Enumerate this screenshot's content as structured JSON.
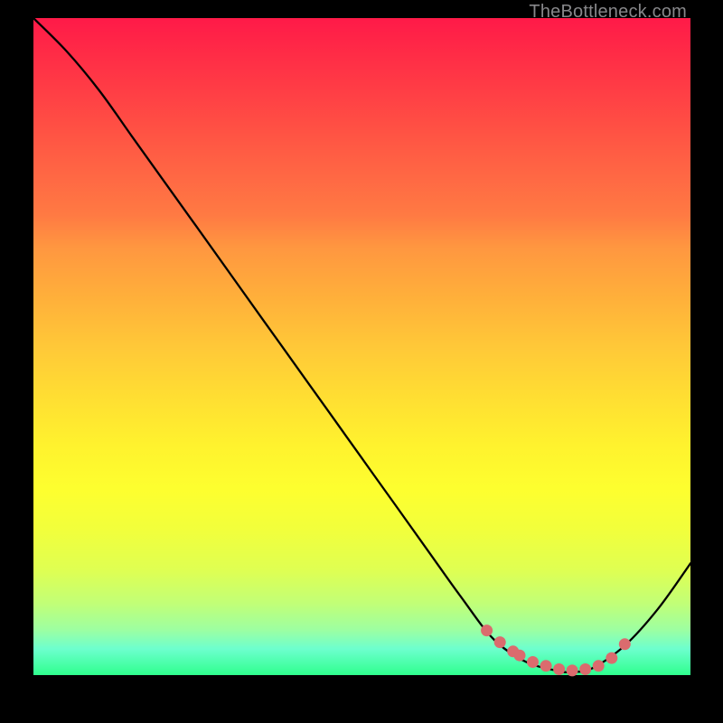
{
  "watermark": "TheBottleneck.com",
  "chart_data": {
    "type": "line",
    "title": "",
    "xlabel": "",
    "ylabel": "",
    "xlim": [
      0,
      100
    ],
    "ylim": [
      0,
      100
    ],
    "series": [
      {
        "name": "bottleneck-curve",
        "color": "#000000",
        "x": [
          0,
          5,
          10,
          15,
          20,
          25,
          30,
          35,
          40,
          45,
          50,
          55,
          60,
          65,
          70,
          75,
          80,
          82,
          85,
          90,
          95,
          100
        ],
        "values": [
          100,
          95,
          89,
          82,
          75,
          68,
          61,
          54,
          47,
          40,
          33,
          26,
          19,
          12,
          5.5,
          2.0,
          0.6,
          0.5,
          1.0,
          4.5,
          10,
          17
        ]
      },
      {
        "name": "highlight-dots",
        "color": "#db6b6e",
        "x": [
          69,
          71,
          73,
          74,
          76,
          78,
          80,
          82,
          84,
          86,
          88,
          90
        ],
        "values": [
          6.8,
          5.0,
          3.6,
          3.0,
          2.0,
          1.4,
          0.9,
          0.7,
          0.9,
          1.4,
          2.6,
          4.7
        ]
      }
    ]
  }
}
